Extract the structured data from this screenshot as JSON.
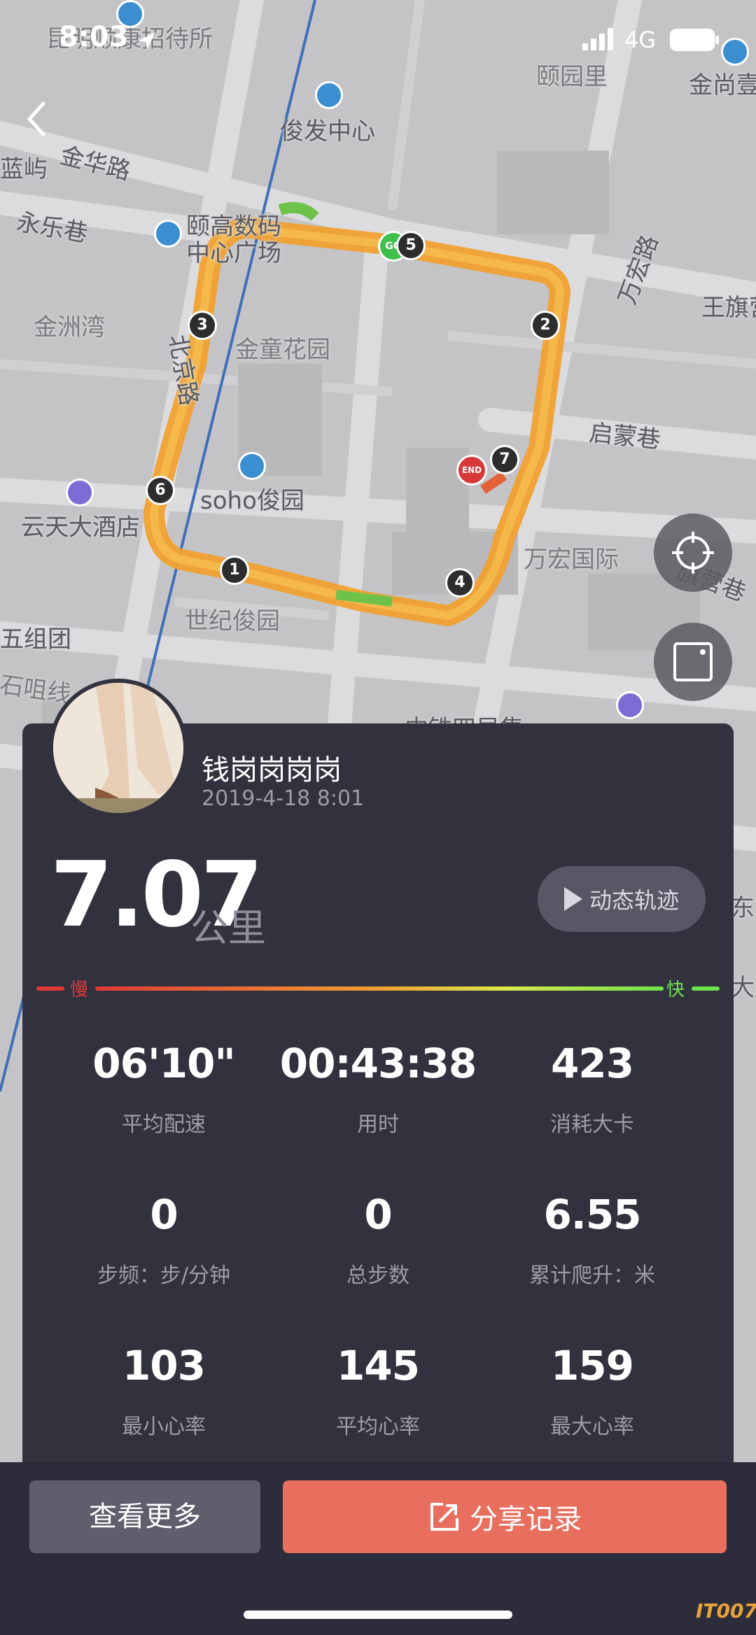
{
  "status_bar": {
    "time": "8:03",
    "network": "4G"
  },
  "map": {
    "labels": [
      "昆明顺康招待所",
      "颐园里",
      "金尚壹",
      "俊发中心",
      "金华路",
      "永乐巷",
      "颐高数码",
      "中心广场",
      "万宏路",
      "王旗营",
      "金洲湾",
      "金童花园",
      "北京路",
      "启蒙巷",
      "soho俊园",
      "云天大酒店",
      "万宏国际",
      "旗营巷",
      "世纪俊园",
      "五组团",
      "石咀线",
      "中铁四局集",
      "东客",
      "大厦",
      "蓝屿"
    ],
    "markers": {
      "start": "GO",
      "end": "END",
      "km": [
        "1",
        "2",
        "3",
        "4",
        "5",
        "6",
        "7"
      ]
    }
  },
  "speed_colors": {
    "slow": "#e23838",
    "mid": "#f0a030",
    "fast": "#6ee24a"
  },
  "profile": {
    "username": "钱岗岗岗岗",
    "datetime": "2019-4-18 8:01"
  },
  "summary": {
    "distance": "7.07",
    "unit": "公里",
    "track_button": "动态轨迹"
  },
  "speed_legend": {
    "slow": "慢",
    "fast": "快"
  },
  "stats": [
    {
      "value": "06'10\"",
      "label": "平均配速"
    },
    {
      "value": "00:43:38",
      "label": "用时"
    },
    {
      "value": "423",
      "label": "消耗大卡"
    },
    {
      "value": "0",
      "label": "步频：步/分钟"
    },
    {
      "value": "0",
      "label": "总步数"
    },
    {
      "value": "6.55",
      "label": "累计爬升：米"
    },
    {
      "value": "103",
      "label": "最小心率"
    },
    {
      "value": "145",
      "label": "平均心率"
    },
    {
      "value": "159",
      "label": "最大心率"
    }
  ],
  "buttons": {
    "more": "查看更多",
    "share": "分享记录"
  },
  "watermark": "IT007"
}
